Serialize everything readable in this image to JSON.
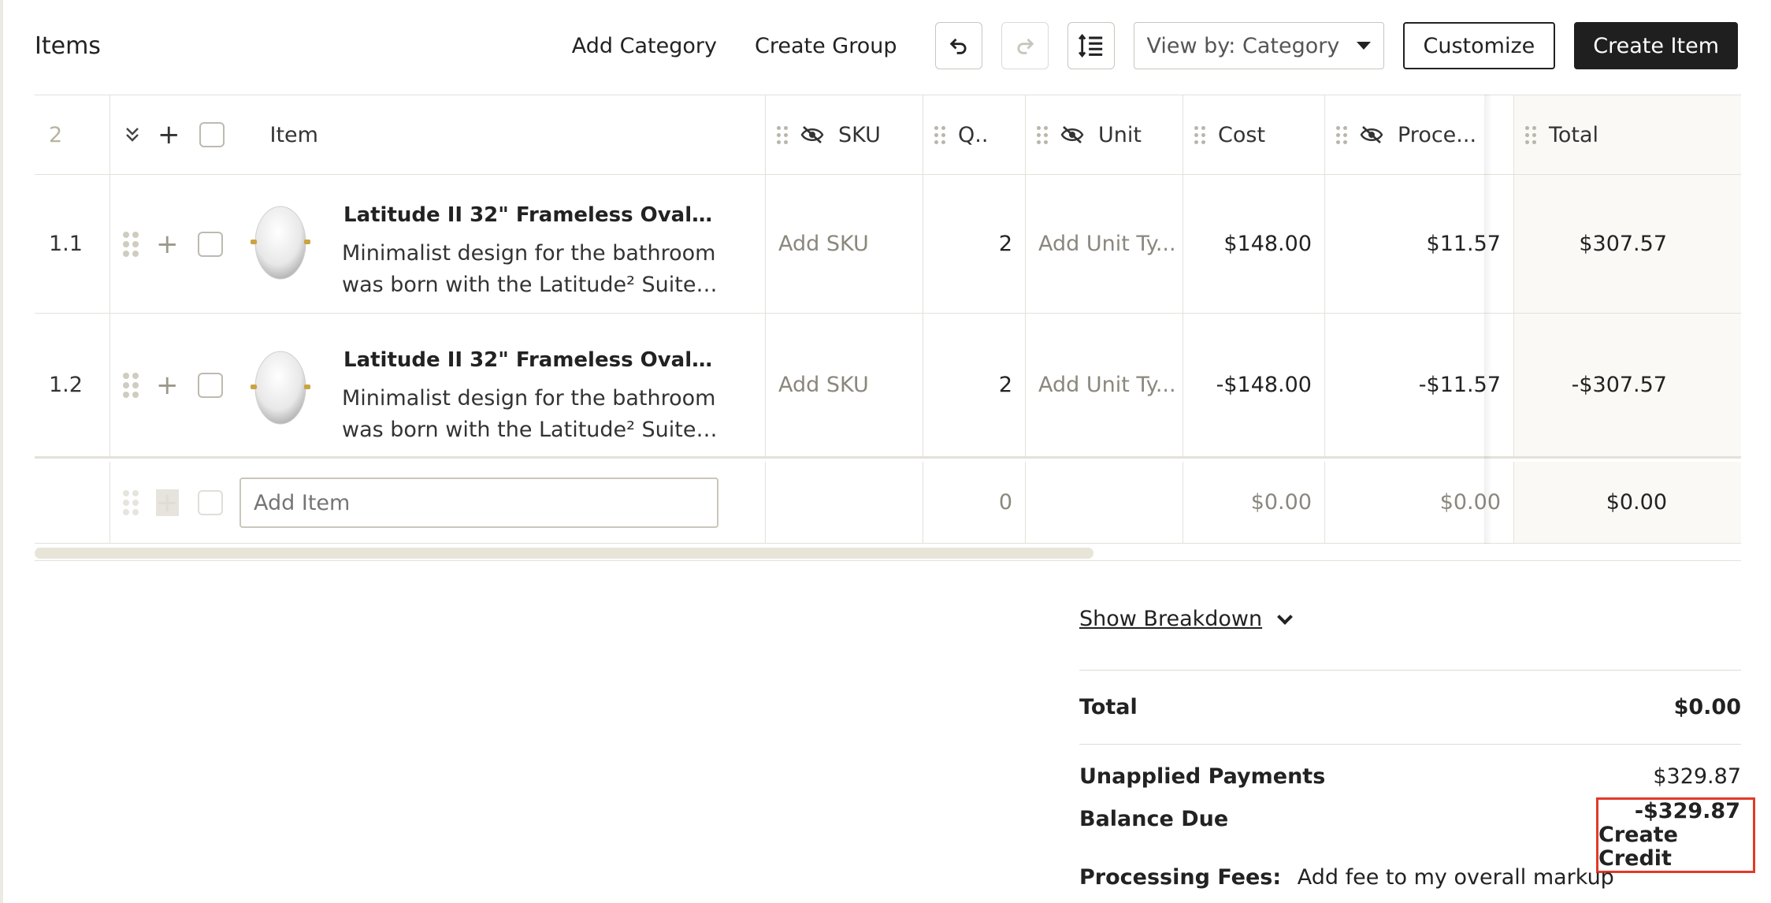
{
  "header": {
    "title": "Items",
    "add_category": "Add Category",
    "create_group": "Create Group",
    "view_by": "View by: Category",
    "customize": "Customize",
    "create_item": "Create Item"
  },
  "table": {
    "columns": {
      "index": "2",
      "item": "Item",
      "sku": "SKU",
      "qty": "Q..",
      "unit": "Unit",
      "cost": "Cost",
      "processing": "Proce...",
      "total": "Total"
    },
    "rows": [
      {
        "index": "1.1",
        "title": "Latitude II 32\" Frameless Oval Mirro...",
        "desc_line1": "Minimalist design for the bathroom",
        "desc_line2": "was born with the Latitude² Suite. Th...",
        "sku": "Add SKU",
        "qty": "2",
        "unit": "Add Unit Ty...",
        "cost": "$148.00",
        "processing": "$11.57",
        "total": "$307.57"
      },
      {
        "index": "1.2",
        "title": "Latitude II 32\" Frameless Oval Mirro...",
        "desc_line1": "Minimalist design for the bathroom",
        "desc_line2": "was born with the Latitude² Suite. Th...",
        "sku": "Add SKU",
        "qty": "2",
        "unit": "Add Unit Ty...",
        "cost": "-$148.00",
        "processing": "-$11.57",
        "total": "-$307.57"
      }
    ],
    "add_row": {
      "placeholder": "Add Item",
      "qty": "0",
      "cost": "$0.00",
      "processing": "$0.00",
      "total": "$0.00"
    }
  },
  "summary": {
    "show_breakdown": "Show Breakdown",
    "total_label": "Total",
    "total_value": "$0.00",
    "unapplied_label": "Unapplied Payments",
    "unapplied_value": "$329.87",
    "balance_label": "Balance Due",
    "balance_value": "-$329.87",
    "create_credit": "Create Credit",
    "fees_label": "Processing Fees:",
    "fees_value": "Add fee to my overall markup"
  },
  "colors": {
    "primary": "#1f1f1f",
    "highlight": "#e03a2a",
    "border": "#e3e1da"
  }
}
